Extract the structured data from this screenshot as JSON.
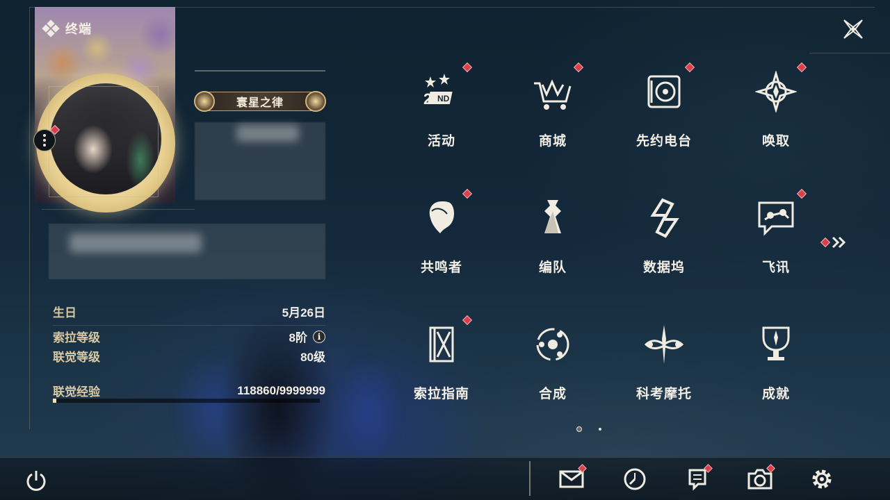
{
  "header": {
    "title": "终端",
    "title_icon": "four-diamond-icon",
    "close_icon": "close-x-icon"
  },
  "profile": {
    "title_name": "寰星之律",
    "menu_icon": "more-dots-icon",
    "stats": {
      "birthday_label": "生日",
      "birthday_value": "5月26日",
      "sola_level_label": "索拉等级",
      "sola_level_value": "8阶",
      "union_level_label": "联觉等级",
      "union_level_value": "80级",
      "union_exp_label": "联觉经验",
      "union_exp_value": "118860/9999999",
      "union_exp_fraction": 0.0119
    }
  },
  "menu": {
    "items": [
      {
        "label": "活动",
        "icon": "event-2nd-anniversary-icon",
        "badge": true
      },
      {
        "label": "商城",
        "icon": "shop-cart-icon",
        "badge": true
      },
      {
        "label": "先约电台",
        "icon": "radio-player-icon",
        "badge": true
      },
      {
        "label": "唤取",
        "icon": "convene-star-icon",
        "badge": true
      },
      {
        "label": "共鸣者",
        "icon": "resonator-portrait-icon",
        "badge": true
      },
      {
        "label": "编队",
        "icon": "team-chess-icon",
        "badge": false
      },
      {
        "label": "数据坞",
        "icon": "data-dock-icon",
        "badge": false
      },
      {
        "label": "飞讯",
        "icon": "message-bubble-icon",
        "badge": true
      },
      {
        "label": "索拉指南",
        "icon": "guidebook-icon",
        "badge": true
      },
      {
        "label": "合成",
        "icon": "synthesis-orbit-icon",
        "badge": false
      },
      {
        "label": "科考摩托",
        "icon": "motorcycle-icon",
        "badge": false
      },
      {
        "label": "成就",
        "icon": "trophy-icon",
        "badge": false
      }
    ],
    "next_icon": "double-chevron-right-icon",
    "current_page": 1,
    "page_count": 2
  },
  "bottom_bar": {
    "power_icon": "power-icon",
    "buttons": [
      {
        "icon": "mail-icon",
        "badge": true
      },
      {
        "icon": "clock-icon",
        "badge": false
      },
      {
        "icon": "notice-icon",
        "badge": true
      },
      {
        "icon": "camera-icon",
        "badge": true
      },
      {
        "icon": "settings-gear-icon",
        "badge": false
      }
    ]
  },
  "colors": {
    "accent_gold": "#d9c9a2",
    "badge_red": "#d8414c",
    "text_light": "#f3efe6"
  }
}
